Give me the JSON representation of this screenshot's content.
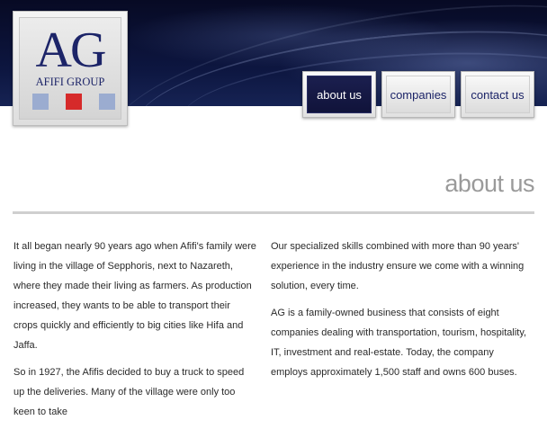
{
  "brand": {
    "monogram": "AG",
    "name": "AFIFI GROUP",
    "colors": {
      "navy": "#1c2468",
      "square_left": "#9bacd0",
      "square_mid": "#d62a2a",
      "square_right": "#9bacd0"
    }
  },
  "nav": {
    "items": [
      {
        "label": "about us",
        "active": true
      },
      {
        "label": "companies",
        "active": false
      },
      {
        "label": "contact us",
        "active": false
      }
    ]
  },
  "page": {
    "title": "about us"
  },
  "content": {
    "left": [
      " It all began nearly 90 years ago when Afifi's family were living in the village of Sepphoris, next to Nazareth, where they made their living as farmers. As production increased, they wants to be able to transport their crops quickly and efficiently to big cities like Hifa and Jaffa.",
      "So in 1927, the Afifis decided to buy a truck to speed up the deliveries. Many of the village were only too keen to take"
    ],
    "right": [
      "Our specialized skills combined with more than 90 years' experience in the industry ensure we come with a winning solution, every time.",
      "AG is a family-owned business that consists of eight companies dealing with transportation, tourism, hospitality, IT, investment and real-estate. Today, the company employs approximately 1,500 staff and owns 600 buses."
    ]
  }
}
